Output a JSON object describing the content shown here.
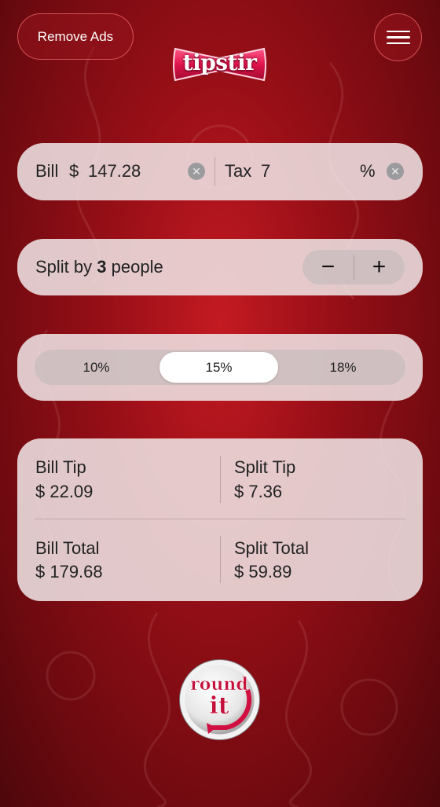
{
  "header": {
    "remove_ads_label": "Remove Ads",
    "logo_text": "tipstir"
  },
  "bill_row": {
    "bill_label": "Bill",
    "currency": "$",
    "bill_value": "147.28",
    "tax_label": "Tax",
    "tax_value": "7",
    "tax_unit": "%"
  },
  "split": {
    "prefix": "Split by",
    "count": "3",
    "suffix": "people",
    "minus": "−",
    "plus": "+"
  },
  "tip_options": {
    "options": [
      "10%",
      "15%",
      "18%"
    ],
    "selected": "15%"
  },
  "results": {
    "bill_tip_label": "Bill Tip",
    "bill_tip_value": "$ 22.09",
    "split_tip_label": "Split Tip",
    "split_tip_value": "$ 7.36",
    "bill_total_label": "Bill Total",
    "bill_total_value": "$ 179.68",
    "split_total_label": "Split Total",
    "split_total_value": "$ 59.89"
  },
  "round_button": {
    "line1": "round",
    "line2": "it"
  },
  "colors": {
    "background": "#9a0f17",
    "card": "#eee2e4",
    "accent": "#d01040"
  }
}
